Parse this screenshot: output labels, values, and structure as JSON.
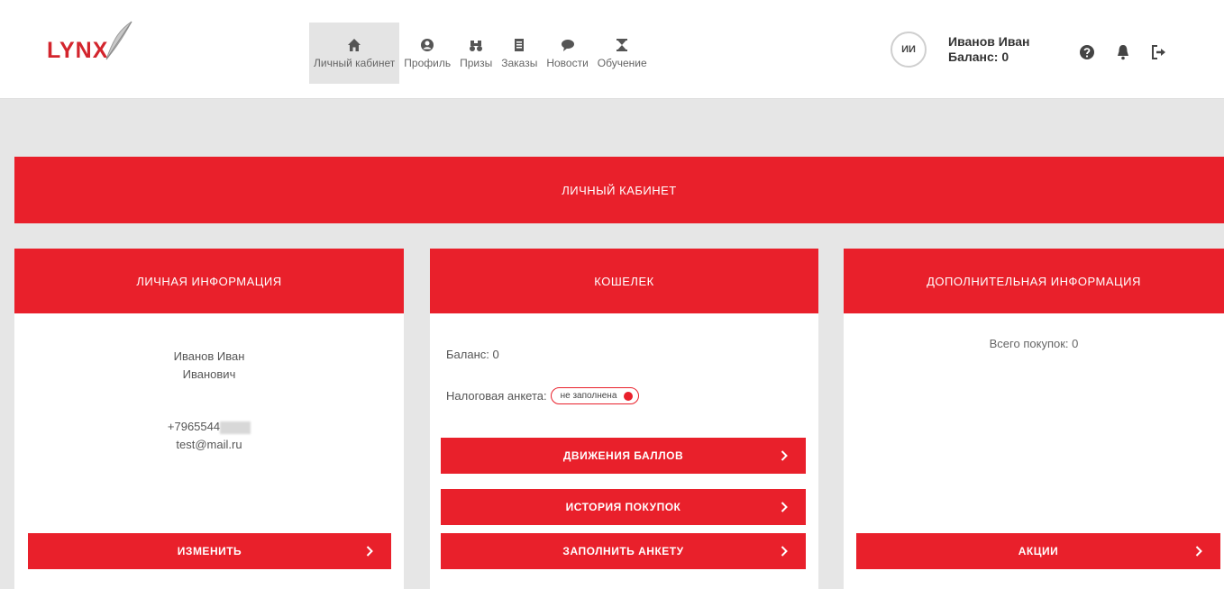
{
  "app": {
    "logo_text": "LYNX"
  },
  "nav": [
    {
      "label": "Личный кабинет",
      "icon": "home-icon",
      "active": true
    },
    {
      "label": "Профиль",
      "icon": "user-circle-icon"
    },
    {
      "label": "Призы",
      "icon": "binoculars-icon"
    },
    {
      "label": "Заказы",
      "icon": "document-icon"
    },
    {
      "label": "Новости",
      "icon": "chat-bubble-icon"
    },
    {
      "label": "Обучение",
      "icon": "hourglass-icon"
    }
  ],
  "user": {
    "initials": "ИИ",
    "name": "Иванов Иван",
    "balance_label": "Баланс: 0"
  },
  "header_icons": [
    "help-icon",
    "bell-icon",
    "logout-icon"
  ],
  "banner": {
    "title": "ЛИЧНЫЙ КАБИНЕТ"
  },
  "personal": {
    "title": "ЛИЧНАЯ ИНФОРМАЦИЯ",
    "name_line1": "Иванов Иван",
    "name_line2": "Иванович",
    "phone": "+7965544",
    "email": "test@mail.ru",
    "edit_button": "ИЗМЕНИТЬ"
  },
  "wallet": {
    "title": "КОШЕЛЕК",
    "balance_label": "Баланс:",
    "balance_value": "0",
    "tax_label": "Налоговая анкета:",
    "tax_status": "не заполнена",
    "buttons": [
      "ДВИЖЕНИЯ БАЛЛОВ",
      "ИСТОРИЯ ПОКУПОК",
      "ЗАПОЛНИТЬ АНКЕТУ"
    ]
  },
  "extra": {
    "title": "ДОПОЛНИТЕЛЬНАЯ ИНФОРМАЦИЯ",
    "purchases_line": "Всего покупок: 0",
    "promo_button": "АКЦИИ"
  },
  "colors": {
    "brand_red": "#e9202b",
    "logo_red": "#d3252d",
    "background": "#e6e6e6"
  }
}
